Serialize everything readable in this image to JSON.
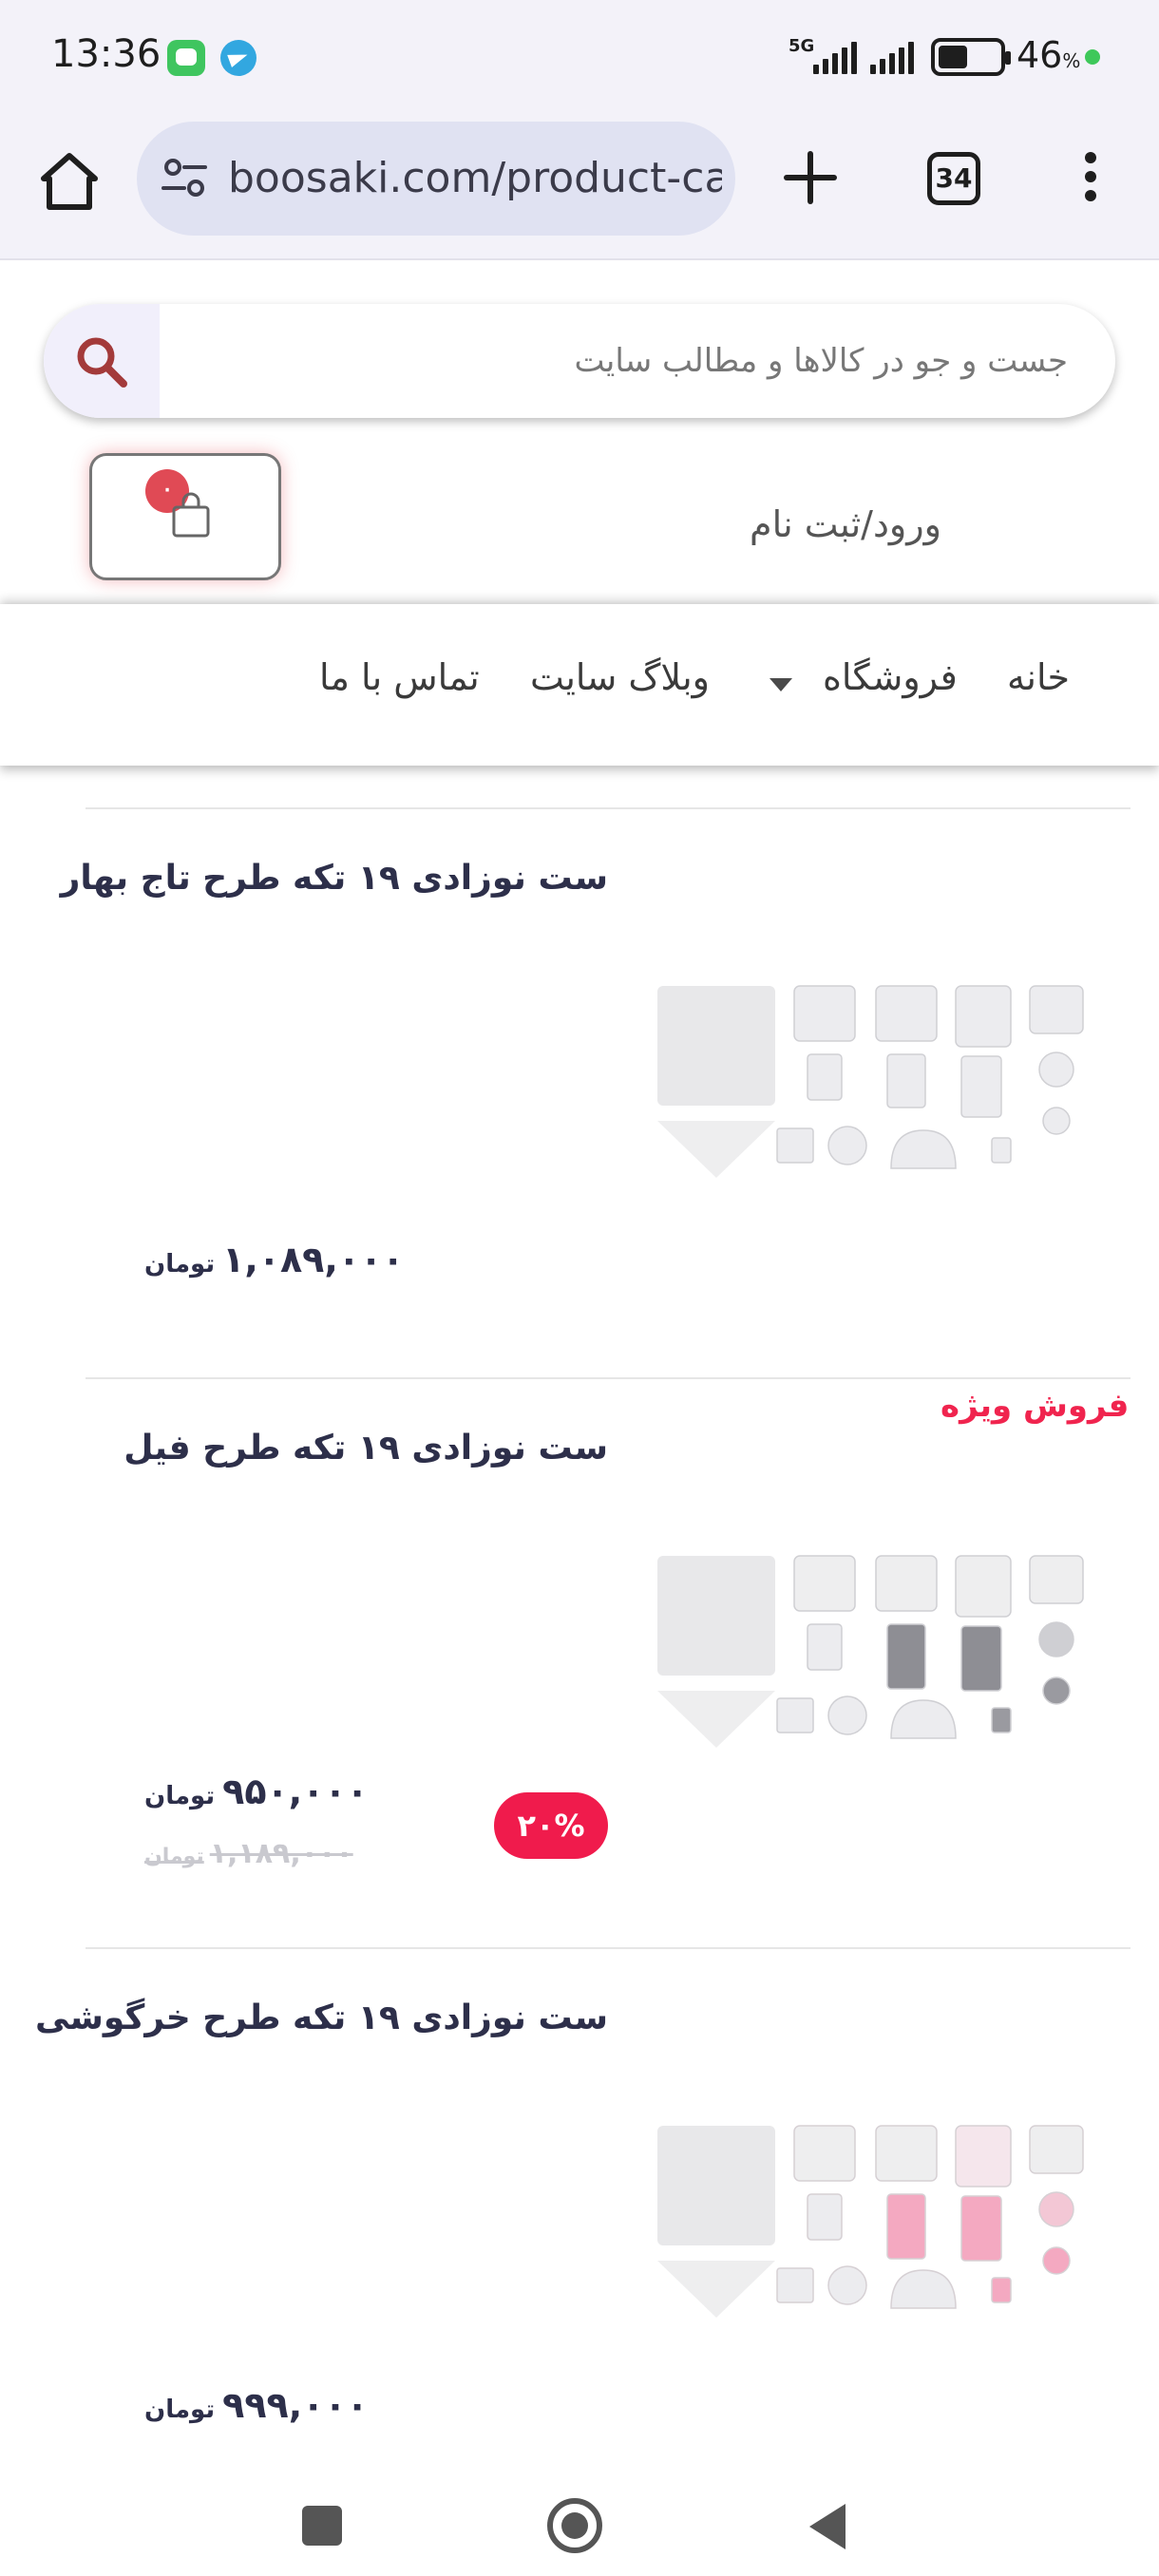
{
  "status_bar": {
    "time": "13:36",
    "network": "5G",
    "battery_percent": "46",
    "battery_unit": "%",
    "icons": [
      "messages-app-icon",
      "telegram-icon",
      "signal-icon",
      "battery-icon"
    ]
  },
  "browser": {
    "url": "boosaki.com/product-category",
    "tab_count": "34"
  },
  "header": {
    "search_placeholder": "جست و جو در کالاها و مطالب سایت",
    "cart_count": "۰",
    "login_label": "ورود/ثبت نام"
  },
  "nav": {
    "items": [
      {
        "label": "خانه"
      },
      {
        "label": "فروشگاه"
      },
      {
        "label": "وبلاگ سایت"
      },
      {
        "label": "تماس با ما"
      }
    ]
  },
  "products": [
    {
      "title": "ست نوزادی ۱۹ تکه طرح تاج بهار",
      "price": "۱,۰۸۹,۰۰۰",
      "currency": "تومان",
      "accent": "#c9ced6"
    },
    {
      "title": "ست نوزادی ۱۹ تکه طرح فیل",
      "sale_label": "فروش ویژه",
      "discount": "۲۰%",
      "price": "۹۵۰,۰۰۰",
      "old_price": "۱,۱۸۹,۰۰۰",
      "currency": "تومان",
      "accent": "#8e8e94"
    },
    {
      "title": "ست نوزادی ۱۹ تکه طرح خرگوشی",
      "price": "۹۹۹,۰۰۰",
      "currency": "تومان",
      "accent": "#f4a9c1"
    }
  ],
  "colors": {
    "brand_red": "#f01b4c",
    "title_text": "#2d2f4a",
    "search_icon": "#a33a3a"
  }
}
